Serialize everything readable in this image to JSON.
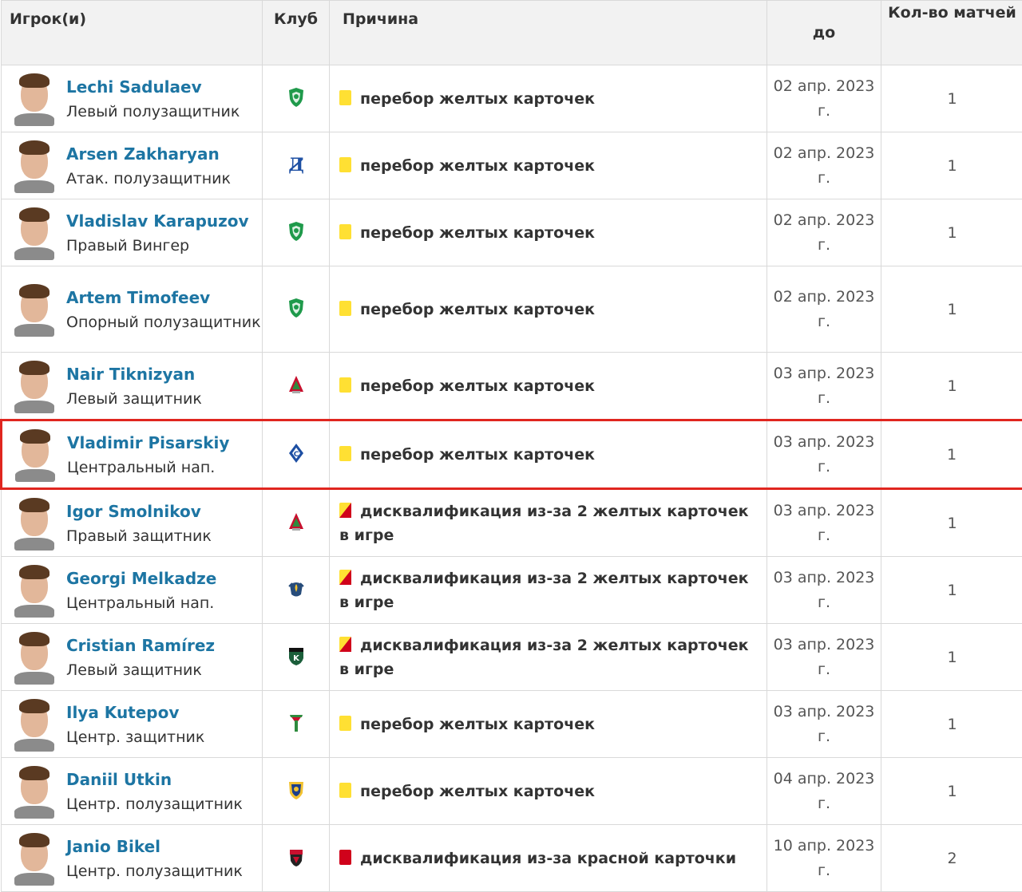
{
  "headers": {
    "player": "Игрок(и)",
    "club": "Клуб",
    "reason": "Причина",
    "until": "до",
    "count": "Кол-во матчей"
  },
  "colors": {
    "link": "#1d75a3",
    "yellow_card": "#ffe033",
    "red_card": "#d0021b",
    "highlight": "#e0261f"
  },
  "rows": [
    {
      "name": "Lechi Sadulaev",
      "position": "Левый полузащитник",
      "club_icon": "akhmat-crest-icon",
      "card": "yellow",
      "reason": "перебор желтых карточек",
      "until": "02 апр. 2023 г.",
      "count": "1"
    },
    {
      "name": "Arsen Zakharyan",
      "position": "Атак. полузащитник",
      "club_icon": "dynamo-crest-icon",
      "card": "yellow",
      "reason": "перебор желтых карточек",
      "until": "02 апр. 2023 г.",
      "count": "1"
    },
    {
      "name": "Vladislav Karapuzov",
      "position": "Правый Вингер",
      "club_icon": "akhmat-crest-icon",
      "card": "yellow",
      "reason": "перебор желтых карточек",
      "until": "02 апр. 2023 г.",
      "count": "1"
    },
    {
      "name": "Artem Timofeev",
      "position": "Опорный полузащитник",
      "club_icon": "akhmat-crest-icon",
      "card": "yellow",
      "reason": "перебор желтых карточек",
      "until": "02 апр. 2023 г.",
      "count": "1"
    },
    {
      "name": "Nair Tiknizyan",
      "position": "Левый защитник",
      "club_icon": "lokomotiv-crest-icon",
      "card": "yellow",
      "reason": "перебор желтых карточек",
      "until": "03 апр. 2023 г.",
      "count": "1"
    },
    {
      "name": "Vladimir Pisarskiy",
      "position": "Центральный нап.",
      "club_icon": "krylia-crest-icon",
      "card": "yellow",
      "reason": "перебор желтых карточек",
      "until": "03 апр. 2023 г.",
      "count": "1"
    },
    {
      "name": "Igor Smolnikov",
      "position": "Правый защитник",
      "club_icon": "lokomotiv-crest-icon",
      "card": "yellow-red",
      "reason": "дисквалификация из-за 2 желтых карточек в игре",
      "until": "03 апр. 2023 г.",
      "count": "1"
    },
    {
      "name": "Georgi Melkadze",
      "position": "Центральный нап.",
      "club_icon": "fakel-crest-icon",
      "card": "yellow-red",
      "reason": "дисквалификация из-за 2 желтых карточек в игре",
      "until": "03 апр. 2023 г.",
      "count": "1"
    },
    {
      "name": "Cristian Ramírez",
      "position": "Левый защитник",
      "club_icon": "krasnodar-crest-icon",
      "card": "yellow-red",
      "reason": "дисквалификация из-за 2 желтых карточек в игре",
      "until": "03 апр. 2023 г.",
      "count": "1"
    },
    {
      "name": "Ilya Kutepov",
      "position": "Центр. защитник",
      "club_icon": "torpedo-crest-icon",
      "card": "yellow",
      "reason": "перебор желтых карточек",
      "until": "03 апр. 2023 г.",
      "count": "1"
    },
    {
      "name": "Daniil Utkin",
      "position": "Центр. полузащитник",
      "club_icon": "rostov-crest-icon",
      "card": "yellow",
      "reason": "перебор желтых карточек",
      "until": "04 апр. 2023 г.",
      "count": "1"
    },
    {
      "name": "Janio Bikel",
      "position": "Центр. полузащитник",
      "club_icon": "khimki-crest-icon",
      "card": "red",
      "reason": "дисквалификация из-за красной карточки",
      "until": "10 апр. 2023 г.",
      "count": "2"
    }
  ]
}
